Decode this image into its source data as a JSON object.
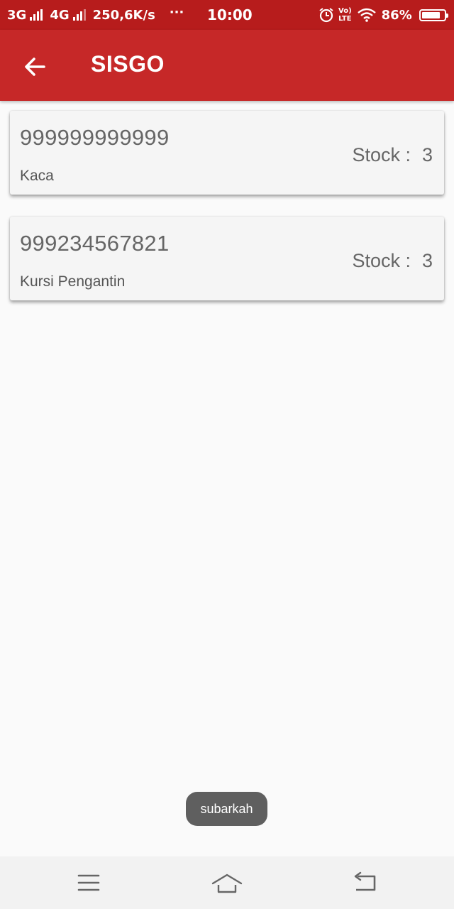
{
  "status_bar": {
    "net1": "3G",
    "net2": "4G",
    "speed": "250,6K/s",
    "dots": "···",
    "time": "10:00",
    "volte_top": "Vo)",
    "volte_bottom": "LTE",
    "battery": "86%",
    "battery_level": 0.86
  },
  "app_bar": {
    "title": "SISGO",
    "color": "#c62828",
    "status_color": "#b71c1c"
  },
  "items": [
    {
      "code": "999999999999",
      "name": "Kaca",
      "stock_label": "Stock :",
      "stock_value": "3"
    },
    {
      "code": "999234567821",
      "name": "Kursi Pengantin",
      "stock_label": "Stock :",
      "stock_value": "3"
    }
  ],
  "toast": {
    "text": "subarkah"
  },
  "nav_bar": {
    "icons": [
      "menu-icon",
      "home-icon",
      "back-icon"
    ]
  }
}
